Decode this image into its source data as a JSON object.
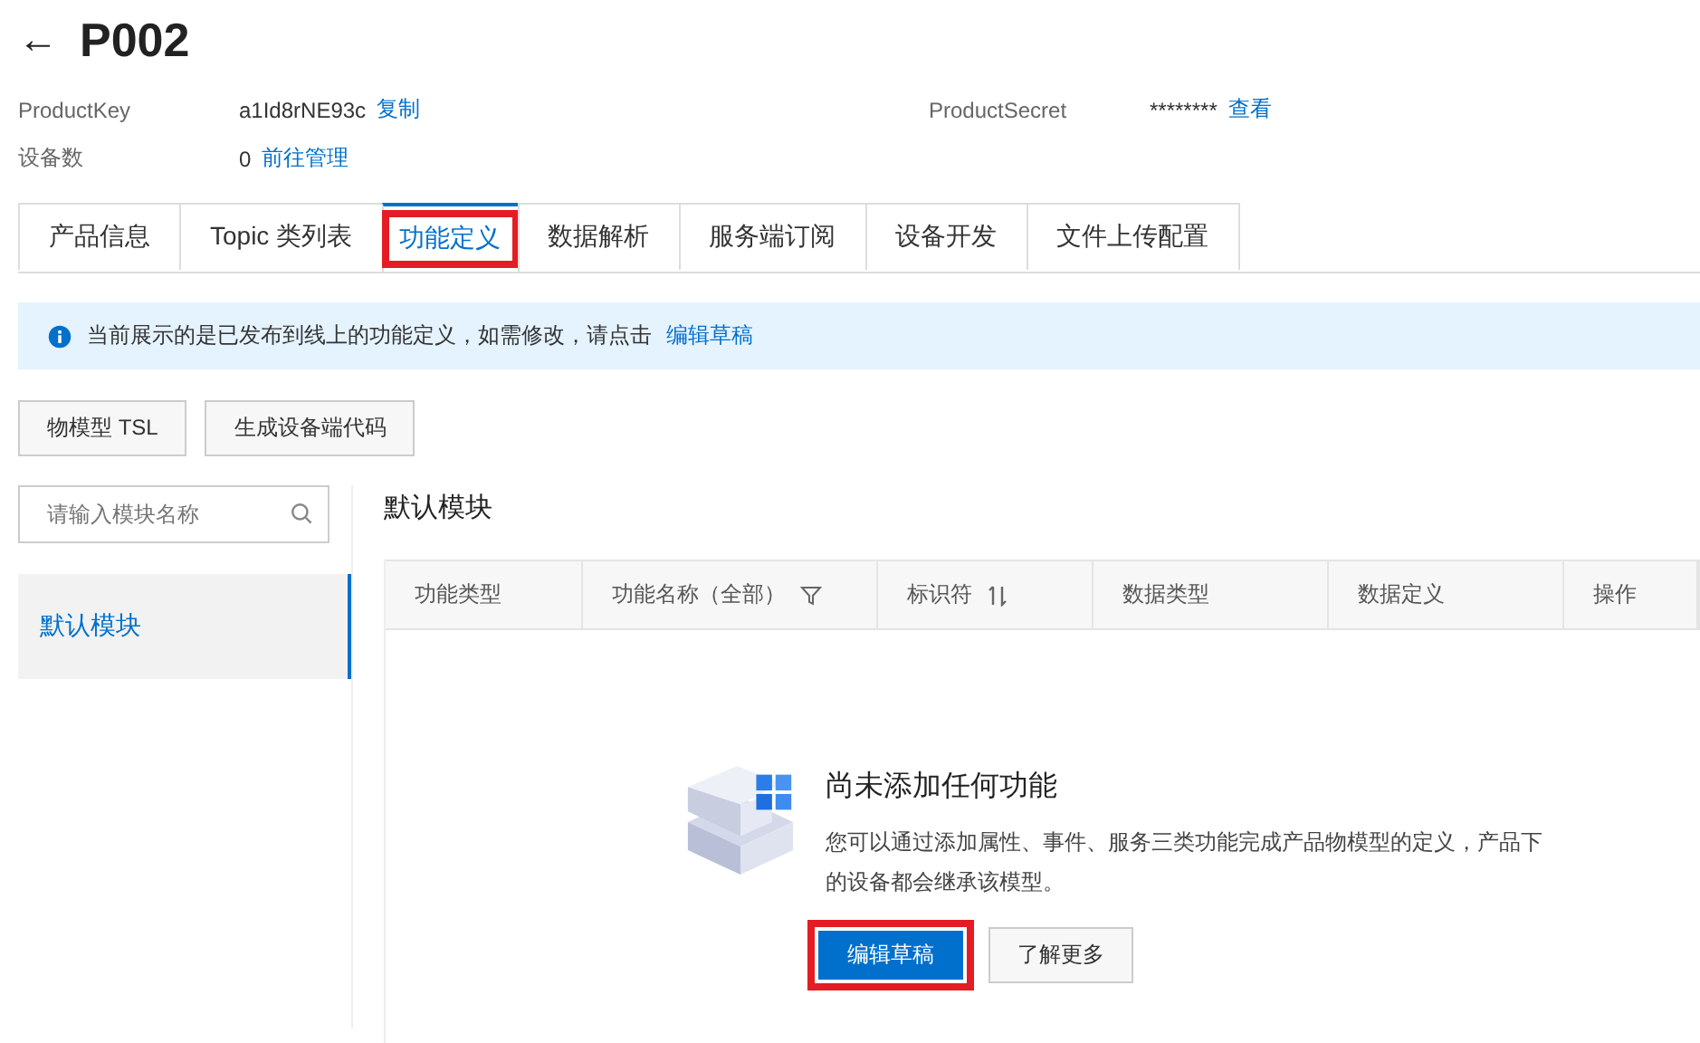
{
  "header": {
    "back": "←",
    "title": "P002"
  },
  "info": [
    {
      "label": "ProductKey",
      "value": "a1Id8rNE93c",
      "link": "复制"
    },
    {
      "label": "ProductSecret",
      "value": "********",
      "link": "查看"
    },
    {
      "label": "设备数",
      "value": "0",
      "link": "前往管理"
    }
  ],
  "tabs": [
    {
      "label": "产品信息",
      "selected": false,
      "highlighted": false
    },
    {
      "label": "Topic 类列表",
      "selected": false,
      "highlighted": false
    },
    {
      "label": "功能定义",
      "selected": true,
      "highlighted": true
    },
    {
      "label": "数据解析",
      "selected": false,
      "highlighted": false
    },
    {
      "label": "服务端订阅",
      "selected": false,
      "highlighted": false
    },
    {
      "label": "设备开发",
      "selected": false,
      "highlighted": false
    },
    {
      "label": "文件上传配置",
      "selected": false,
      "highlighted": false
    }
  ],
  "alert": {
    "text": "当前展示的是已发布到线上的功能定义，如需修改，请点击",
    "link": "编辑草稿"
  },
  "toolbar": [
    "物模型 TSL",
    "生成设备端代码"
  ],
  "modules": {
    "search": {
      "placeholder": "请输入模块名称"
    },
    "items": [
      {
        "label": "默认模块",
        "selected": true
      }
    ]
  },
  "module_title": "默认模块",
  "table": {
    "columns": [
      {
        "label": "功能类型",
        "kind": "plain"
      },
      {
        "label": "功能名称（全部）",
        "kind": "filter"
      },
      {
        "label": "标识符",
        "kind": "sort"
      },
      {
        "label": "数据类型",
        "kind": "plain"
      },
      {
        "label": "数据定义",
        "kind": "plain"
      },
      {
        "label": "操作",
        "kind": "plain"
      }
    ]
  },
  "empty": {
    "title": "尚未添加任何功能",
    "text": "您可以通过添加属性、事件、服务三类功能完成产品物模型的定义，产品下的设备都会继承该模型。",
    "buttons": [
      {
        "label": "编辑草稿",
        "primary": true,
        "highlighted": true
      },
      {
        "label": "了解更多",
        "primary": false,
        "highlighted": false
      }
    ]
  }
}
